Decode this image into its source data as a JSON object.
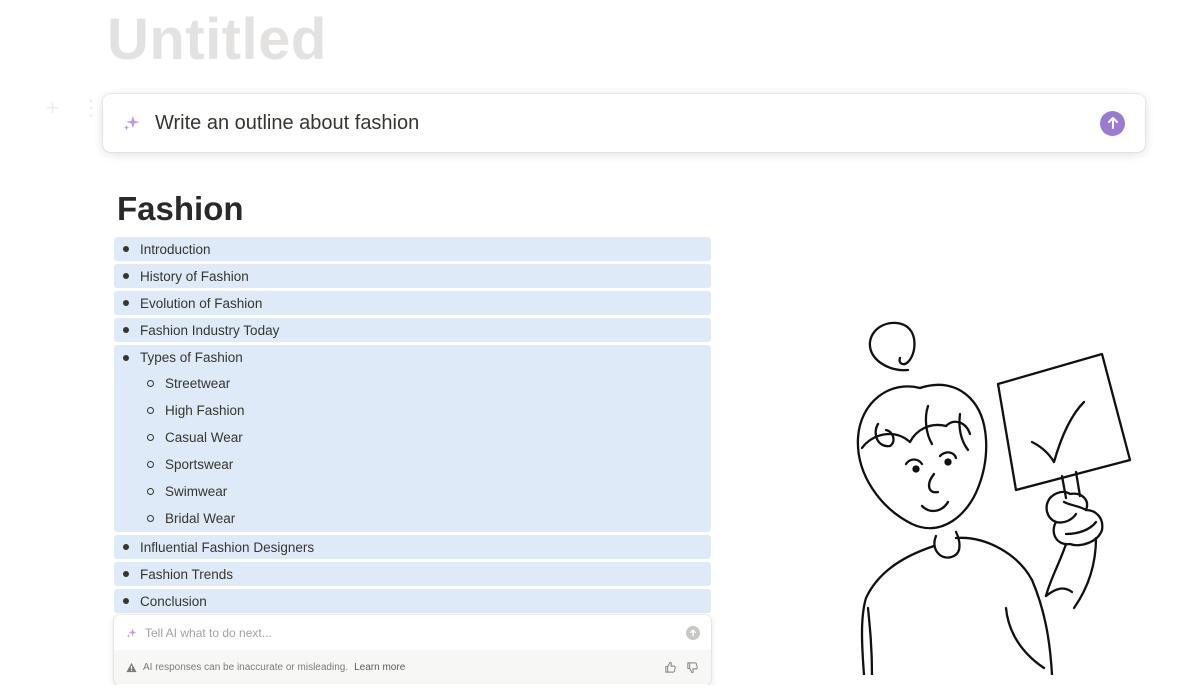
{
  "page": {
    "title": "Untitled"
  },
  "prompt": {
    "text": "Write an outline about fashion",
    "icon": "sparkle-icon",
    "send_icon": "arrow-up-icon",
    "accent": "#9a7bd1"
  },
  "document": {
    "title": "Fashion",
    "highlight_color": "#deeaf8",
    "outline": {
      "introduction": "Introduction",
      "history": "History of Fashion",
      "evolution": "Evolution of Fashion",
      "industry": "Fashion Industry Today",
      "types": {
        "label": "Types of Fashion",
        "children": [
          "Streetwear",
          "High Fashion",
          "Casual Wear",
          "Sportswear",
          "Swimwear",
          "Bridal Wear"
        ]
      },
      "designers": "Influential Fashion Designers",
      "trends": "Fashion Trends",
      "conclusion": "Conclusion"
    }
  },
  "ai_panel": {
    "placeholder": "Tell AI what to do next...",
    "disclaimer": "AI responses can be inaccurate or misleading.",
    "learn_more": "Learn more",
    "icons": [
      "sparkle-icon",
      "arrow-up-icon",
      "warning-icon",
      "thumbs-up-icon",
      "thumbs-down-icon"
    ]
  }
}
